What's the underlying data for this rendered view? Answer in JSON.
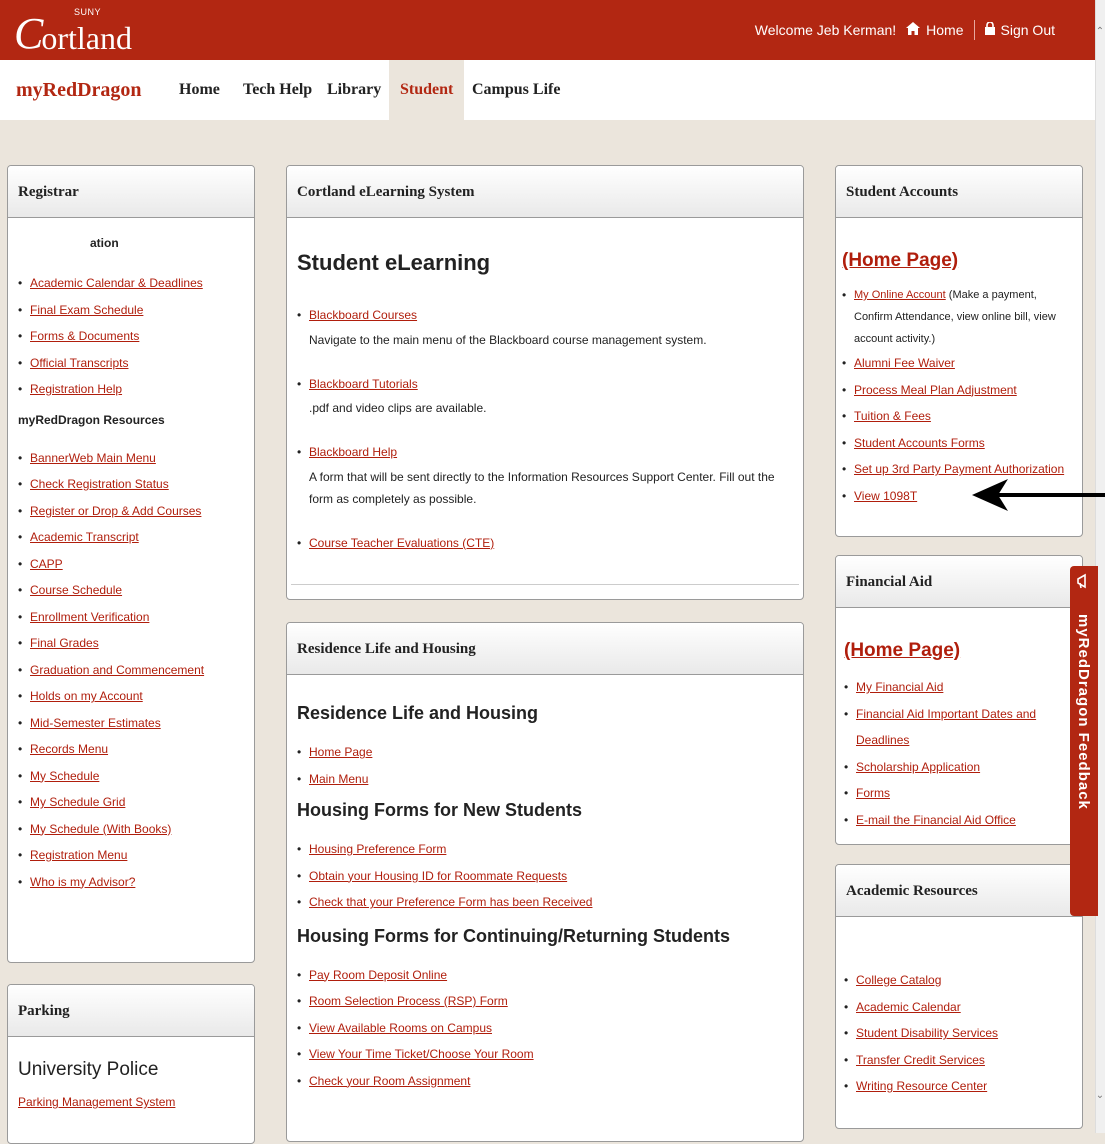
{
  "header": {
    "logo_suny": "SUNY",
    "logo_initial": "C",
    "logo_word": "ortland",
    "welcome": "Welcome Jeb Kerman!",
    "home": "Home",
    "signout": "Sign Out"
  },
  "nav": {
    "brand": "myRedDragon",
    "items": [
      {
        "label": "Home"
      },
      {
        "label": "Tech Help"
      },
      {
        "label": "Library"
      },
      {
        "label": "Student",
        "active": true
      },
      {
        "label": "Campus Life"
      }
    ]
  },
  "registrar": {
    "title": "Registrar",
    "partial_heading": "ation",
    "links1": [
      "Academic Calendar & Deadlines",
      "Final Exam Schedule",
      "Forms & Documents",
      "Official Transcripts",
      "Registration Help"
    ],
    "resources_title": "myRedDragon Resources",
    "links2": [
      "BannerWeb Main Menu",
      "Check Registration Status",
      "Register or Drop & Add Courses",
      "Academic Transcript",
      "CAPP",
      "Course Schedule",
      "Enrollment Verification",
      "Final Grades",
      "Graduation and Commencement",
      "Holds on my Account",
      "Mid-Semester Estimates",
      "Records Menu",
      "My Schedule",
      "My Schedule Grid",
      "My Schedule (With Books)",
      "Registration Menu",
      "Who is my Advisor?"
    ]
  },
  "parking": {
    "title": "Parking",
    "subtitle": "University Police",
    "link": "Parking Management System"
  },
  "elearning": {
    "title": "Cortland eLearning System",
    "heading": "Student eLearning",
    "items": [
      {
        "link": "Blackboard Courses",
        "desc": "Navigate to the main menu of the Blackboard course management system."
      },
      {
        "link": "Blackboard Tutorials",
        "desc": ".pdf and video clips are available."
      },
      {
        "link": "Blackboard Help",
        "desc": "A form that will be sent directly to the Information Resources Support Center. Fill out the form as completely as possible."
      },
      {
        "link": "Course Teacher Evaluations (CTE)",
        "desc": ""
      }
    ]
  },
  "housing": {
    "title": "Residence Life and Housing",
    "heading": "Residence Life and Housing",
    "links1": [
      "Home Page",
      "Main Menu"
    ],
    "new_title": "Housing Forms for New Students",
    "links2": [
      "Housing Preference Form",
      "Obtain your Housing ID for Roommate Requests",
      "Check that your Preference Form has been Received"
    ],
    "cont_title": "Housing Forms for Continuing/Returning Students",
    "links3": [
      "Pay Room Deposit Online",
      "Room Selection Process (RSP) Form",
      "View Available Rooms on Campus",
      "View Your Time Ticket/Choose Your Room",
      "Check your Room Assignment"
    ]
  },
  "accounts": {
    "title": "Student Accounts",
    "home": "(Home Page)",
    "first_link": "My Online Account",
    "first_note": "(Make a payment, Confirm Attendance, view online bill, view account activity.)",
    "links": [
      "Alumni Fee Waiver",
      "Process Meal Plan Adjustment",
      "Tuition & Fees",
      "Student Accounts Forms",
      "Set up 3rd Party Payment Authorization",
      "View 1098T"
    ]
  },
  "finaid": {
    "title": "Financial Aid",
    "home": "(Home Page)",
    "links": [
      "My Financial Aid",
      "Financial Aid Important Dates and Deadlines",
      "Scholarship Application",
      "Forms",
      "E-mail the Financial Aid Office"
    ]
  },
  "academic": {
    "title": "Academic Resources",
    "links": [
      "College Catalog",
      "Academic Calendar",
      "Student Disability Services",
      "Transfer Credit Services",
      "Writing Resource Center"
    ]
  },
  "feedback": {
    "label": "myRedDragon Feedback"
  },
  "colors": {
    "brand": "#b22712",
    "link": "#b01e0c",
    "page_bg": "#ebe5dc"
  }
}
